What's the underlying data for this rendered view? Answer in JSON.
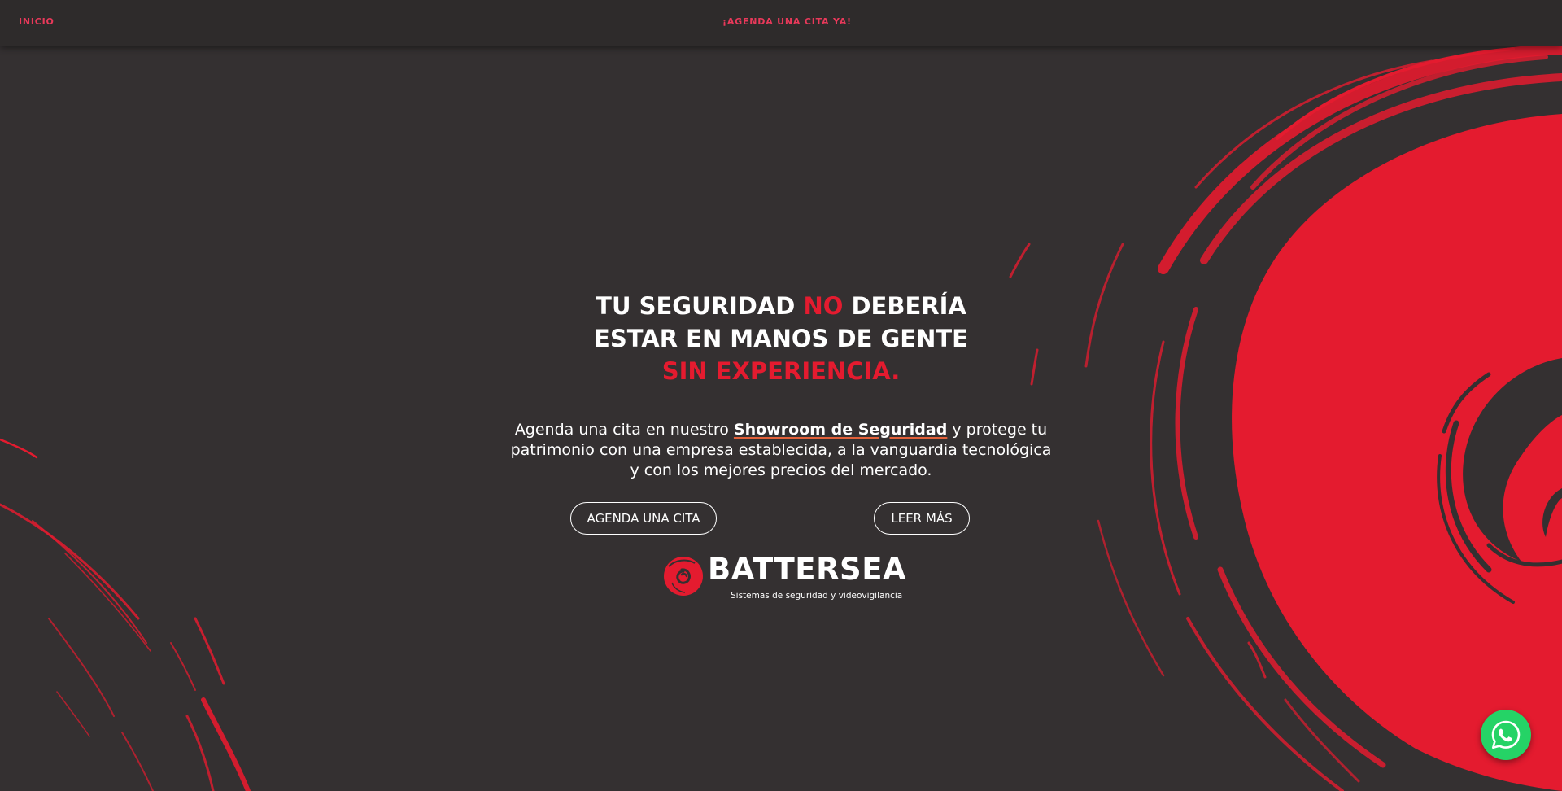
{
  "nav": {
    "inicio": "INICIO",
    "agenda": "¡AGENDA UNA CITA YA!"
  },
  "hero": {
    "headline": {
      "part1": "TU SEGURIDAD ",
      "highlight1": "NO",
      "part2": " DEBERÍA",
      "line2": "ESTAR EN MANOS DE GENTE",
      "line3": "SIN EXPERIENCIA."
    },
    "lead": {
      "before": "Agenda una cita en nuestro ",
      "highlight": "Showroom de Seguridad",
      "after": " y protege tu patrimonio con una empresa establecida, a la vanguardia tecnológica y con los mejores precios del mercado."
    },
    "buttons": {
      "primary": "AGENDA UNA CITA",
      "secondary": "LEER MÁS"
    }
  },
  "logo": {
    "name": "BATTERSEA",
    "tagline": "Sistemas de seguridad y videovigilancia"
  },
  "icons": {
    "whatsapp": "whatsapp-icon",
    "logo_mark": "battersea-swirl-icon"
  },
  "colors": {
    "background": "#343031",
    "accent_red": "#e41b2f",
    "nav_link": "#e8395a",
    "underline": "#e2613a",
    "whatsapp": "#25d366"
  }
}
